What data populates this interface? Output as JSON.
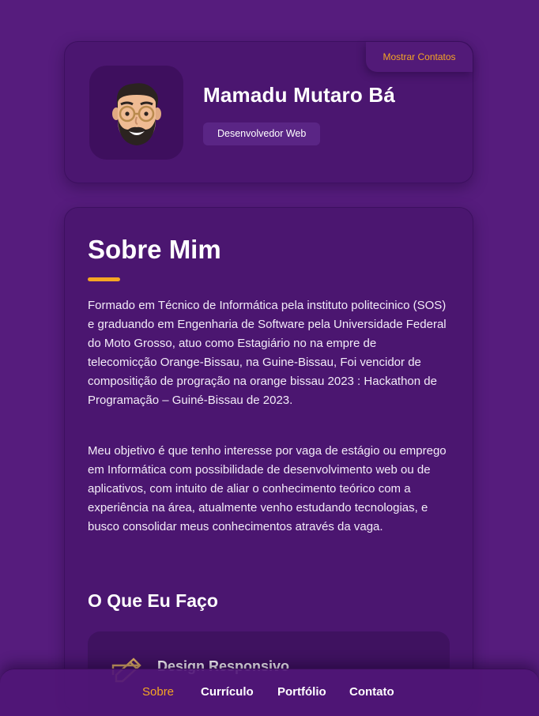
{
  "profile": {
    "name": "Mamadu Mutaro Bá",
    "role": "Desenvolvedor Web",
    "contacts_button": "Mostrar Contatos",
    "avatar_icon": "memoji-avatar-icon"
  },
  "about": {
    "title": "Sobre Mim",
    "paragraphs": [
      "Formado em Técnico de Informática pela instituto politecinico (SOS) e graduando em Engenharia de Software pela Universidade Federal do Moto Grosso, atuo como Estagiário no na empre de telecomicção Orange-Bissau, na Guine-Bissau, Foi vencidor de compositição de progração na orange bissau 2023 : Hackathon de Programação – Guiné-Bissau de 2023.",
      "Meu objetivo é que tenho interesse por vaga de estágio ou emprego em Informática com possibilidade de desenvolvimento web ou de aplicativos, com intuito de aliar o conhecimento teórico com a experiência na área, atualmente venho estudando tecnologias, e busco consolidar meus conhecimentos através da vaga."
    ]
  },
  "services": {
    "title": "O Que Eu Faço",
    "items": [
      {
        "title": "Design Responsivo",
        "icon": "design-pencil-icon"
      }
    ]
  },
  "nav": {
    "items": [
      {
        "label": "Sobre",
        "active": true
      },
      {
        "label": "Currículo",
        "active": false
      },
      {
        "label": "Portfólio",
        "active": false
      },
      {
        "label": "Contato",
        "active": false
      }
    ]
  },
  "colors": {
    "background": "#561c7d",
    "card": "#4b1670",
    "accent": "#f5a623"
  }
}
